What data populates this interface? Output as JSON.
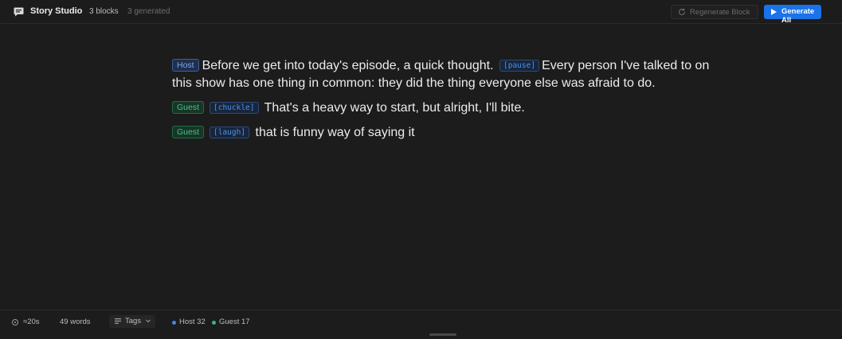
{
  "header": {
    "app_icon": "chat-bubble-icon",
    "title": "Story Studio",
    "blocks_count": "3 blocks",
    "generated_count": "3 generated",
    "regenerate_label": "Regenerate Block",
    "regenerate_icon": "refresh-icon",
    "generate_all_label": "Generate All",
    "generate_all_icon": "play-icon"
  },
  "blocks": [
    {
      "speaker": "Host",
      "text_before": "Before we get into today's episode, a quick thought.",
      "tag": "[pause]",
      "text_after": "Every person I've talked to on this show has one thing in common: they did the thing everyone else was afraid to do."
    },
    {
      "speaker": "Guest",
      "tag": "[chuckle]",
      "text_after": "That's a heavy way to start, but alright, I'll bite."
    },
    {
      "speaker": "Guest",
      "tag": "[laugh]",
      "text_after": "that is funny way of saying it"
    }
  ],
  "footer": {
    "duration": "≈20s",
    "duration_icon": "clock-icon",
    "words": "49 words",
    "tags_label": "Tags",
    "tags_icon": "tags-icon",
    "host_stat": "Host 32",
    "guest_stat": "Guest 17"
  },
  "colors": {
    "accent": "#1a73e8",
    "host": "#3d8be8",
    "guest": "#2bbf7f",
    "background": "#1c1c1c"
  }
}
